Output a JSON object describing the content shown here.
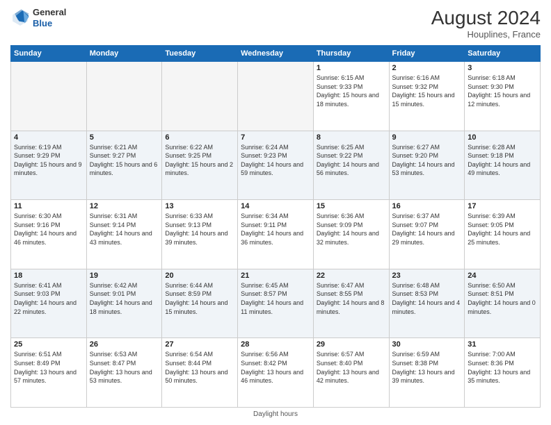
{
  "header": {
    "logo_general": "General",
    "logo_blue": "Blue",
    "month_year": "August 2024",
    "location": "Houplines, France"
  },
  "days_of_week": [
    "Sunday",
    "Monday",
    "Tuesday",
    "Wednesday",
    "Thursday",
    "Friday",
    "Saturday"
  ],
  "weeks": [
    {
      "days": [
        {
          "date": "",
          "empty": true
        },
        {
          "date": "",
          "empty": true
        },
        {
          "date": "",
          "empty": true
        },
        {
          "date": "",
          "empty": true
        },
        {
          "date": "1",
          "sunrise": "6:15 AM",
          "sunset": "9:33 PM",
          "daylight": "15 hours and 18 minutes."
        },
        {
          "date": "2",
          "sunrise": "6:16 AM",
          "sunset": "9:32 PM",
          "daylight": "15 hours and 15 minutes."
        },
        {
          "date": "3",
          "sunrise": "6:18 AM",
          "sunset": "9:30 PM",
          "daylight": "15 hours and 12 minutes."
        }
      ]
    },
    {
      "days": [
        {
          "date": "4",
          "sunrise": "6:19 AM",
          "sunset": "9:29 PM",
          "daylight": "15 hours and 9 minutes."
        },
        {
          "date": "5",
          "sunrise": "6:21 AM",
          "sunset": "9:27 PM",
          "daylight": "15 hours and 6 minutes."
        },
        {
          "date": "6",
          "sunrise": "6:22 AM",
          "sunset": "9:25 PM",
          "daylight": "15 hours and 2 minutes."
        },
        {
          "date": "7",
          "sunrise": "6:24 AM",
          "sunset": "9:23 PM",
          "daylight": "14 hours and 59 minutes."
        },
        {
          "date": "8",
          "sunrise": "6:25 AM",
          "sunset": "9:22 PM",
          "daylight": "14 hours and 56 minutes."
        },
        {
          "date": "9",
          "sunrise": "6:27 AM",
          "sunset": "9:20 PM",
          "daylight": "14 hours and 53 minutes."
        },
        {
          "date": "10",
          "sunrise": "6:28 AM",
          "sunset": "9:18 PM",
          "daylight": "14 hours and 49 minutes."
        }
      ]
    },
    {
      "days": [
        {
          "date": "11",
          "sunrise": "6:30 AM",
          "sunset": "9:16 PM",
          "daylight": "14 hours and 46 minutes."
        },
        {
          "date": "12",
          "sunrise": "6:31 AM",
          "sunset": "9:14 PM",
          "daylight": "14 hours and 43 minutes."
        },
        {
          "date": "13",
          "sunrise": "6:33 AM",
          "sunset": "9:13 PM",
          "daylight": "14 hours and 39 minutes."
        },
        {
          "date": "14",
          "sunrise": "6:34 AM",
          "sunset": "9:11 PM",
          "daylight": "14 hours and 36 minutes."
        },
        {
          "date": "15",
          "sunrise": "6:36 AM",
          "sunset": "9:09 PM",
          "daylight": "14 hours and 32 minutes."
        },
        {
          "date": "16",
          "sunrise": "6:37 AM",
          "sunset": "9:07 PM",
          "daylight": "14 hours and 29 minutes."
        },
        {
          "date": "17",
          "sunrise": "6:39 AM",
          "sunset": "9:05 PM",
          "daylight": "14 hours and 25 minutes."
        }
      ]
    },
    {
      "days": [
        {
          "date": "18",
          "sunrise": "6:41 AM",
          "sunset": "9:03 PM",
          "daylight": "14 hours and 22 minutes."
        },
        {
          "date": "19",
          "sunrise": "6:42 AM",
          "sunset": "9:01 PM",
          "daylight": "14 hours and 18 minutes."
        },
        {
          "date": "20",
          "sunrise": "6:44 AM",
          "sunset": "8:59 PM",
          "daylight": "14 hours and 15 minutes."
        },
        {
          "date": "21",
          "sunrise": "6:45 AM",
          "sunset": "8:57 PM",
          "daylight": "14 hours and 11 minutes."
        },
        {
          "date": "22",
          "sunrise": "6:47 AM",
          "sunset": "8:55 PM",
          "daylight": "14 hours and 8 minutes."
        },
        {
          "date": "23",
          "sunrise": "6:48 AM",
          "sunset": "8:53 PM",
          "daylight": "14 hours and 4 minutes."
        },
        {
          "date": "24",
          "sunrise": "6:50 AM",
          "sunset": "8:51 PM",
          "daylight": "14 hours and 0 minutes."
        }
      ]
    },
    {
      "days": [
        {
          "date": "25",
          "sunrise": "6:51 AM",
          "sunset": "8:49 PM",
          "daylight": "13 hours and 57 minutes."
        },
        {
          "date": "26",
          "sunrise": "6:53 AM",
          "sunset": "8:47 PM",
          "daylight": "13 hours and 53 minutes."
        },
        {
          "date": "27",
          "sunrise": "6:54 AM",
          "sunset": "8:44 PM",
          "daylight": "13 hours and 50 minutes."
        },
        {
          "date": "28",
          "sunrise": "6:56 AM",
          "sunset": "8:42 PM",
          "daylight": "13 hours and 46 minutes."
        },
        {
          "date": "29",
          "sunrise": "6:57 AM",
          "sunset": "8:40 PM",
          "daylight": "13 hours and 42 minutes."
        },
        {
          "date": "30",
          "sunrise": "6:59 AM",
          "sunset": "8:38 PM",
          "daylight": "13 hours and 39 minutes."
        },
        {
          "date": "31",
          "sunrise": "7:00 AM",
          "sunset": "8:36 PM",
          "daylight": "13 hours and 35 minutes."
        }
      ]
    }
  ],
  "footer": {
    "note": "Daylight hours"
  }
}
